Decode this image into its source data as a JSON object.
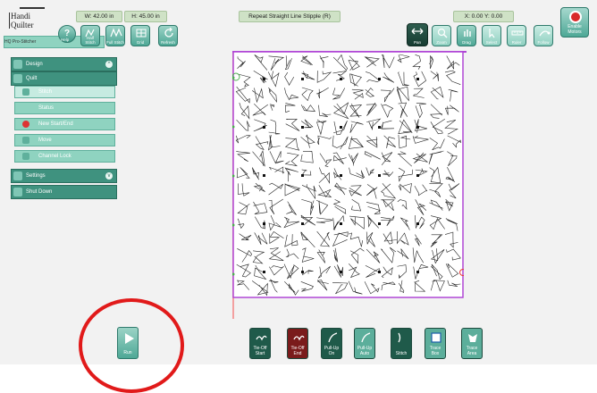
{
  "app": {
    "logo_line1": "Handi",
    "logo_line2": "Quilter",
    "logo_sub": "HQ Pro-Stitcher",
    "width": "W: 42.00 in",
    "height": "H: 45.00 in",
    "pattern_title": "Repeat Straight Line Stipple (R)",
    "coords": "X: 0.00  Y: 0.00"
  },
  "toolbar_left": [
    {
      "label": "Help",
      "icon": "question-icon"
    },
    {
      "label": "Half Stitch",
      "icon": "half-stitch-icon"
    },
    {
      "label": "Full Stitch",
      "icon": "full-stitch-icon"
    },
    {
      "label": "Grid",
      "icon": "grid-icon"
    },
    {
      "label": "Refresh",
      "icon": "refresh-icon"
    }
  ],
  "toolbar_right": [
    {
      "label": "Pan",
      "icon": "pan-arrows-icon"
    },
    {
      "label": "Zoom",
      "icon": "zoom-icon"
    },
    {
      "label": "Drag",
      "icon": "drag-icon"
    },
    {
      "label": "Select",
      "icon": "select-icon"
    },
    {
      "label": "Ruler",
      "icon": "ruler-icon"
    },
    {
      "label": "Follow",
      "icon": "follow-icon"
    }
  ],
  "enable_motors": "Enable Motors",
  "sidebar": {
    "design": "Design",
    "quilt": "Quilt",
    "items": [
      "Stitch",
      "Status",
      "New Start/End",
      "Move",
      "Channel Lock"
    ],
    "settings": "Settings",
    "shutdown": "Shut Down"
  },
  "run": "Run",
  "bottom_buttons": [
    {
      "label": "Tie-Off Start",
      "icon": "tie-off-start-icon",
      "color": "#1f5a4a"
    },
    {
      "label": "Tie-Off End",
      "icon": "tie-off-end-icon",
      "color": "#7a1b1b"
    },
    {
      "label": "Pull-Up On",
      "icon": "pull-up-on-icon",
      "color": "#1f5a4a"
    },
    {
      "label": "Pull-Up Auto",
      "icon": "pull-up-auto-icon",
      "color": "#5cae9b"
    },
    {
      "label": "Stitch",
      "icon": "stitch-icon",
      "color": "#1f5a4a"
    },
    {
      "label": "Trace Box",
      "icon": "trace-box-icon",
      "color": "#5cae9b"
    },
    {
      "label": "Trace Area",
      "icon": "trace-area-icon",
      "color": "#5cae9b"
    }
  ],
  "colors": {
    "accent": "#3f927f",
    "boundary": "#b047d6",
    "start_marker": "#4caf50",
    "end_marker": "#e53935",
    "annotation": "#e11a1a"
  }
}
